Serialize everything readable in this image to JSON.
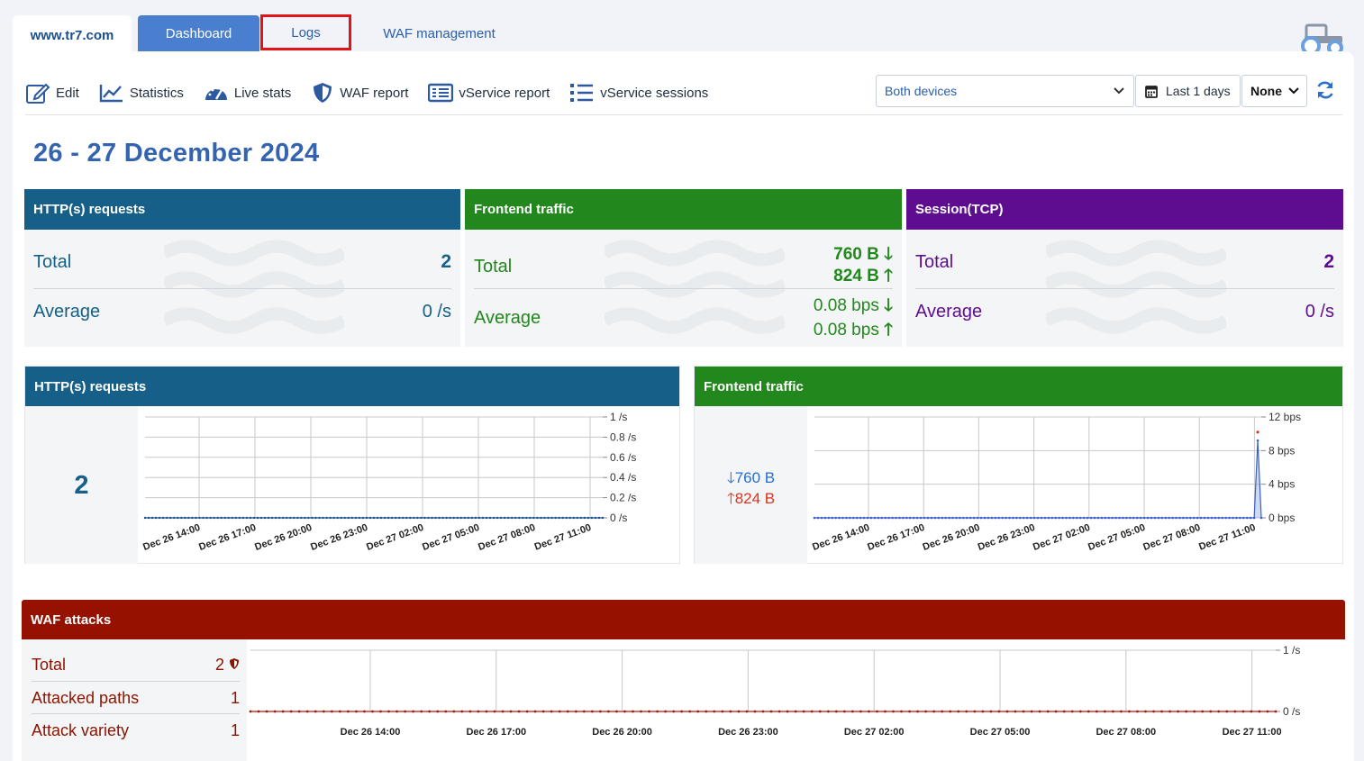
{
  "tabs": {
    "site": "www.tr7.com",
    "dashboard": "Dashboard",
    "logs": "Logs",
    "waf_management": "WAF management"
  },
  "toolbar": {
    "edit": "Edit",
    "statistics": "Statistics",
    "live_stats": "Live stats",
    "waf_report": "WAF report",
    "vservice_report": "vService report",
    "vservice_sessions": "vService sessions",
    "device_select": "Both devices",
    "days": "Last 1 days",
    "none_select": "None"
  },
  "date_title": "26 - 27 December 2024",
  "cards": {
    "http": {
      "title": "HTTP(s) requests",
      "total_label": "Total",
      "total_value": "2",
      "avg_label": "Average",
      "avg_value": "0 /s"
    },
    "frontend": {
      "title": "Frontend traffic",
      "total_label": "Total",
      "total_down": "760 B",
      "total_up": "824 B",
      "avg_label": "Average",
      "avg_down": "0.08 bps",
      "avg_up": "0.08 bps"
    },
    "session": {
      "title": "Session(TCP)",
      "total_label": "Total",
      "total_value": "2",
      "avg_label": "Average",
      "avg_value": "0 /s"
    }
  },
  "panels": {
    "http": {
      "title": "HTTP(s) requests",
      "big_value": "2"
    },
    "frontend": {
      "title": "Frontend traffic",
      "down": "760 B",
      "up": "824 B"
    }
  },
  "waf": {
    "title": "WAF attacks",
    "total_label": "Total",
    "total_value": "2",
    "paths_label": "Attacked paths",
    "paths_value": "1",
    "variety_label": "Attack variety",
    "variety_value": "1"
  },
  "chart_data": [
    {
      "type": "line",
      "series": [
        {
          "values": [
            0,
            0,
            0,
            0,
            0,
            0,
            0,
            0,
            0,
            0,
            0,
            0,
            0,
            0,
            0,
            0,
            0,
            0,
            0,
            0,
            0,
            0,
            0,
            0,
            0,
            0,
            0,
            0,
            0,
            0,
            0,
            0,
            0,
            0,
            0,
            0,
            0,
            0,
            0,
            0,
            0,
            0,
            0,
            0,
            0,
            0,
            0,
            0,
            0,
            0,
            0,
            0,
            0,
            0,
            0,
            0,
            0,
            0,
            0,
            0,
            0,
            0,
            0,
            0,
            0,
            0,
            0,
            0,
            0,
            0,
            0,
            0,
            0,
            0,
            0,
            0,
            0,
            0,
            0,
            0,
            0,
            0,
            0,
            0,
            0,
            0,
            0,
            0,
            0,
            0,
            0,
            0,
            0,
            0,
            0,
            0,
            0,
            0,
            0,
            0,
            0,
            0,
            0,
            0,
            0,
            0,
            0,
            0,
            0,
            0,
            0,
            0,
            0,
            0,
            0,
            0,
            0,
            0,
            0,
            0,
            0,
            0,
            0,
            0,
            0,
            0,
            0
          ]
        }
      ],
      "x_ticks": [
        "Dec 26 14:00",
        "Dec 26 17:00",
        "Dec 26 20:00",
        "Dec 26 23:00",
        "Dec 27 02:00",
        "Dec 27 05:00",
        "Dec 27 08:00",
        "Dec 27 11:00"
      ],
      "y_ticks": [
        "1 /s",
        "0.8 /s",
        "0.6 /s",
        "0.4 /s",
        "0.2 /s",
        "0 /s"
      ],
      "ylim": [
        0,
        1
      ],
      "line_color": "#1a4f8a"
    },
    {
      "type": "area",
      "series": [
        {
          "values_down": [
            0,
            0,
            0,
            0,
            0,
            0,
            0,
            0,
            0,
            0,
            0,
            0,
            0,
            0,
            0,
            0,
            0,
            0,
            0,
            0,
            0,
            0,
            0,
            0,
            0,
            0,
            0,
            0,
            0,
            0,
            0,
            0,
            0,
            0,
            0,
            0,
            0,
            0,
            0,
            0,
            0,
            0,
            0,
            0,
            0,
            0,
            0,
            0,
            0,
            0,
            0,
            0,
            0,
            0,
            0,
            0,
            0,
            0,
            0,
            0,
            0,
            0,
            0,
            0,
            0,
            0,
            0,
            0,
            0,
            0,
            0,
            0,
            0,
            0,
            0,
            0,
            0,
            0,
            0,
            0,
            0,
            0,
            0,
            0,
            0,
            0,
            0,
            0,
            0,
            0,
            0,
            0,
            0,
            0,
            0,
            0,
            0,
            0,
            0,
            0,
            0,
            0,
            0,
            0,
            0,
            0,
            0,
            0,
            0,
            0,
            0,
            0,
            0,
            0,
            0,
            0,
            0,
            0,
            0,
            0,
            0,
            0,
            0,
            0,
            0,
            9.2,
            0
          ]
        },
        {
          "values_up": [
            0,
            0,
            0,
            0,
            0,
            0,
            0,
            0,
            0,
            0,
            0,
            0,
            0,
            0,
            0,
            0,
            0,
            0,
            0,
            0,
            0,
            0,
            0,
            0,
            0,
            0,
            0,
            0,
            0,
            0,
            0,
            0,
            0,
            0,
            0,
            0,
            0,
            0,
            0,
            0,
            0,
            0,
            0,
            0,
            0,
            0,
            0,
            0,
            0,
            0,
            0,
            0,
            0,
            0,
            0,
            0,
            0,
            0,
            0,
            0,
            0,
            0,
            0,
            0,
            0,
            0,
            0,
            0,
            0,
            0,
            0,
            0,
            0,
            0,
            0,
            0,
            0,
            0,
            0,
            0,
            0,
            0,
            0,
            0,
            0,
            0,
            0,
            0,
            0,
            0,
            0,
            0,
            0,
            0,
            0,
            0,
            0,
            0,
            0,
            0,
            0,
            0,
            0,
            0,
            0,
            0,
            0,
            0,
            0,
            0,
            0,
            0,
            0,
            0,
            0,
            0,
            0,
            0,
            0,
            0,
            0,
            0,
            0,
            0,
            0,
            10.2,
            0
          ]
        }
      ],
      "x_ticks": [
        "Dec 26 14:00",
        "Dec 26 17:00",
        "Dec 26 20:00",
        "Dec 26 23:00",
        "Dec 27 02:00",
        "Dec 27 05:00",
        "Dec 27 08:00",
        "Dec 27 11:00"
      ],
      "y_ticks": [
        "12 bps",
        "8 bps",
        "4 bps",
        "0 bps"
      ],
      "ylim": [
        0,
        12
      ],
      "down_color": "#3a5fc8",
      "up_color": "#e0331b"
    },
    {
      "type": "line",
      "series": [
        {
          "values": [
            0,
            0,
            0,
            0,
            0,
            0,
            0,
            0,
            0,
            0,
            0,
            0,
            0,
            0,
            0,
            0,
            0,
            0,
            0,
            0,
            0,
            0,
            0,
            0,
            0,
            0,
            0,
            0,
            0,
            0,
            0,
            0,
            0,
            0,
            0,
            0,
            0,
            0,
            0,
            0,
            0,
            0,
            0,
            0,
            0,
            0,
            0,
            0,
            0,
            0,
            0,
            0,
            0,
            0,
            0,
            0,
            0,
            0,
            0,
            0,
            0,
            0,
            0,
            0,
            0,
            0,
            0,
            0,
            0,
            0,
            0,
            0,
            0,
            0,
            0,
            0,
            0,
            0,
            0,
            0,
            0,
            0,
            0,
            0,
            0,
            0,
            0,
            0,
            0,
            0,
            0,
            0,
            0,
            0,
            0,
            0,
            0,
            0,
            0,
            0,
            0,
            0,
            0,
            0,
            0,
            0,
            0,
            0,
            0,
            0,
            0,
            0,
            0,
            0,
            0,
            0,
            0,
            0,
            0,
            0,
            0,
            0,
            0,
            0,
            0,
            0,
            0
          ]
        }
      ],
      "x_ticks": [
        "Dec 26 14:00",
        "Dec 26 17:00",
        "Dec 26 20:00",
        "Dec 26 23:00",
        "Dec 27 02:00",
        "Dec 27 05:00",
        "Dec 27 08:00",
        "Dec 27 11:00"
      ],
      "y_ticks": [
        "1 /s",
        "0 /s"
      ],
      "ylim": [
        0,
        1
      ],
      "line_color": "#a81a10"
    }
  ]
}
